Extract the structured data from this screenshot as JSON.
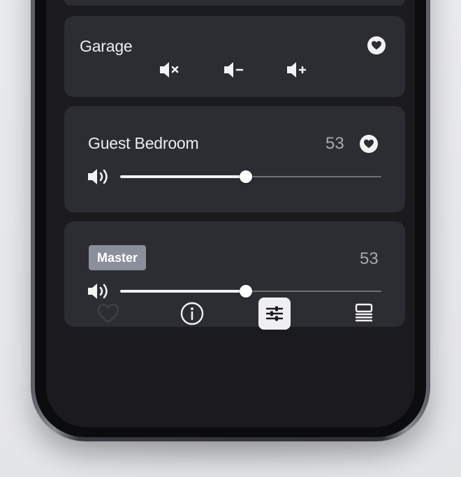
{
  "rooms": {
    "garage": {
      "name": "Garage",
      "favorite_icon": "heart-icon",
      "buttons": [
        "mute",
        "volume-down",
        "volume-up"
      ]
    },
    "guest_bedroom": {
      "name": "Guest Bedroom",
      "volume": "53",
      "volume_fraction": 0.48,
      "favorite_icon": "heart-icon"
    },
    "master": {
      "name": "Master",
      "volume": "53",
      "volume_fraction": 0.48
    }
  },
  "nav": {
    "items": [
      {
        "id": "favorites",
        "icon": "heart-outline-icon",
        "active": false
      },
      {
        "id": "info",
        "icon": "info-icon",
        "active": false
      },
      {
        "id": "mixer",
        "icon": "sliders-icon",
        "active": true
      },
      {
        "id": "rooms",
        "icon": "stack-icon",
        "active": false
      }
    ]
  },
  "colors": {
    "card": "#2c2d32",
    "screen": "#1b1b1e",
    "accent_badge": "#8a8f9b",
    "text": "#ededf0",
    "value_text": "#a7a9b1"
  }
}
